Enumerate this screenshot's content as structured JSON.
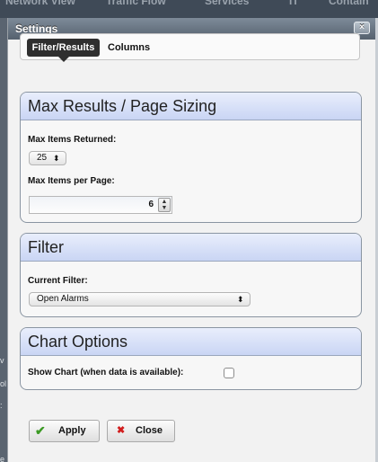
{
  "background": {
    "nav_fragments": [
      "Network View",
      "Traffic Flow",
      "Services",
      "IT",
      "Contain"
    ],
    "left_fragments": [
      "v",
      "ol",
      ":",
      "e"
    ]
  },
  "dialog": {
    "title": "Settings",
    "close_icon": "×",
    "tabs": [
      {
        "label": "Filter/Results",
        "active": true
      },
      {
        "label": "Columns",
        "active": false
      }
    ],
    "max_results_panel": {
      "heading": "Max Results / Page Sizing",
      "max_items_returned_label": "Max Items Returned:",
      "max_items_returned_value": "25",
      "select_arrows": "⬍",
      "max_items_per_page_label": "Max Items per Page:",
      "max_items_per_page_value": "6",
      "stepper_up": "▲",
      "stepper_down": "▼"
    },
    "filter_panel": {
      "heading": "Filter",
      "current_filter_label": "Current Filter:",
      "current_filter_value": "Open Alarms",
      "select_arrows": "⬍"
    },
    "chart_panel": {
      "heading": "Chart Options",
      "show_chart_label": "Show Chart (when data is available):",
      "show_chart_checked": false
    },
    "buttons": {
      "apply_label": "Apply",
      "apply_icon": "✔",
      "close_label": "Close",
      "close_icon": "✖"
    }
  },
  "colors": {
    "titlebar": "#55616e",
    "panel_header": "#c9d5f4",
    "apply_icon": "#3c9a24",
    "close_icon": "#d11d1d"
  }
}
